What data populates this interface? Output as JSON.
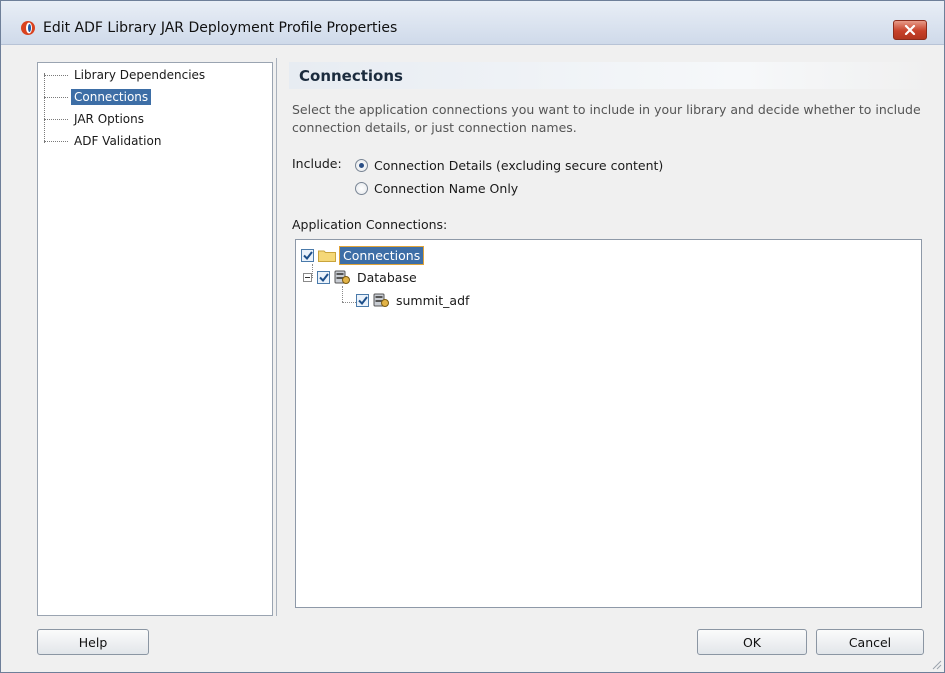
{
  "window": {
    "title": "Edit ADF Library JAR Deployment Profile Properties",
    "icon": "oracle-icon",
    "close_icon": "close-icon"
  },
  "nav": {
    "items": [
      {
        "label": "Library Dependencies",
        "selected": false
      },
      {
        "label": "Connections",
        "selected": true
      },
      {
        "label": "JAR Options",
        "selected": false
      },
      {
        "label": "ADF Validation",
        "selected": false
      }
    ]
  },
  "panel": {
    "title": "Connections",
    "description": "Select the application connections you want to include in your library and decide whether to include connection details, or just connection names.",
    "include_label": "Include:",
    "options": [
      {
        "label": "Connection Details (excluding secure content)",
        "checked": true
      },
      {
        "label": "Connection Name Only",
        "checked": false
      }
    ],
    "app_connections_label": "Application Connections:"
  },
  "tree": {
    "root": {
      "label": "Connections",
      "checked": true
    },
    "database": {
      "label": "Database",
      "checked": true
    },
    "connection": {
      "label": "summit_adf",
      "checked": true
    }
  },
  "buttons": {
    "help": "Help",
    "ok": "OK",
    "cancel": "Cancel"
  },
  "colors": {
    "selection": "#3d6ea6",
    "close_button": "#c7412a"
  }
}
